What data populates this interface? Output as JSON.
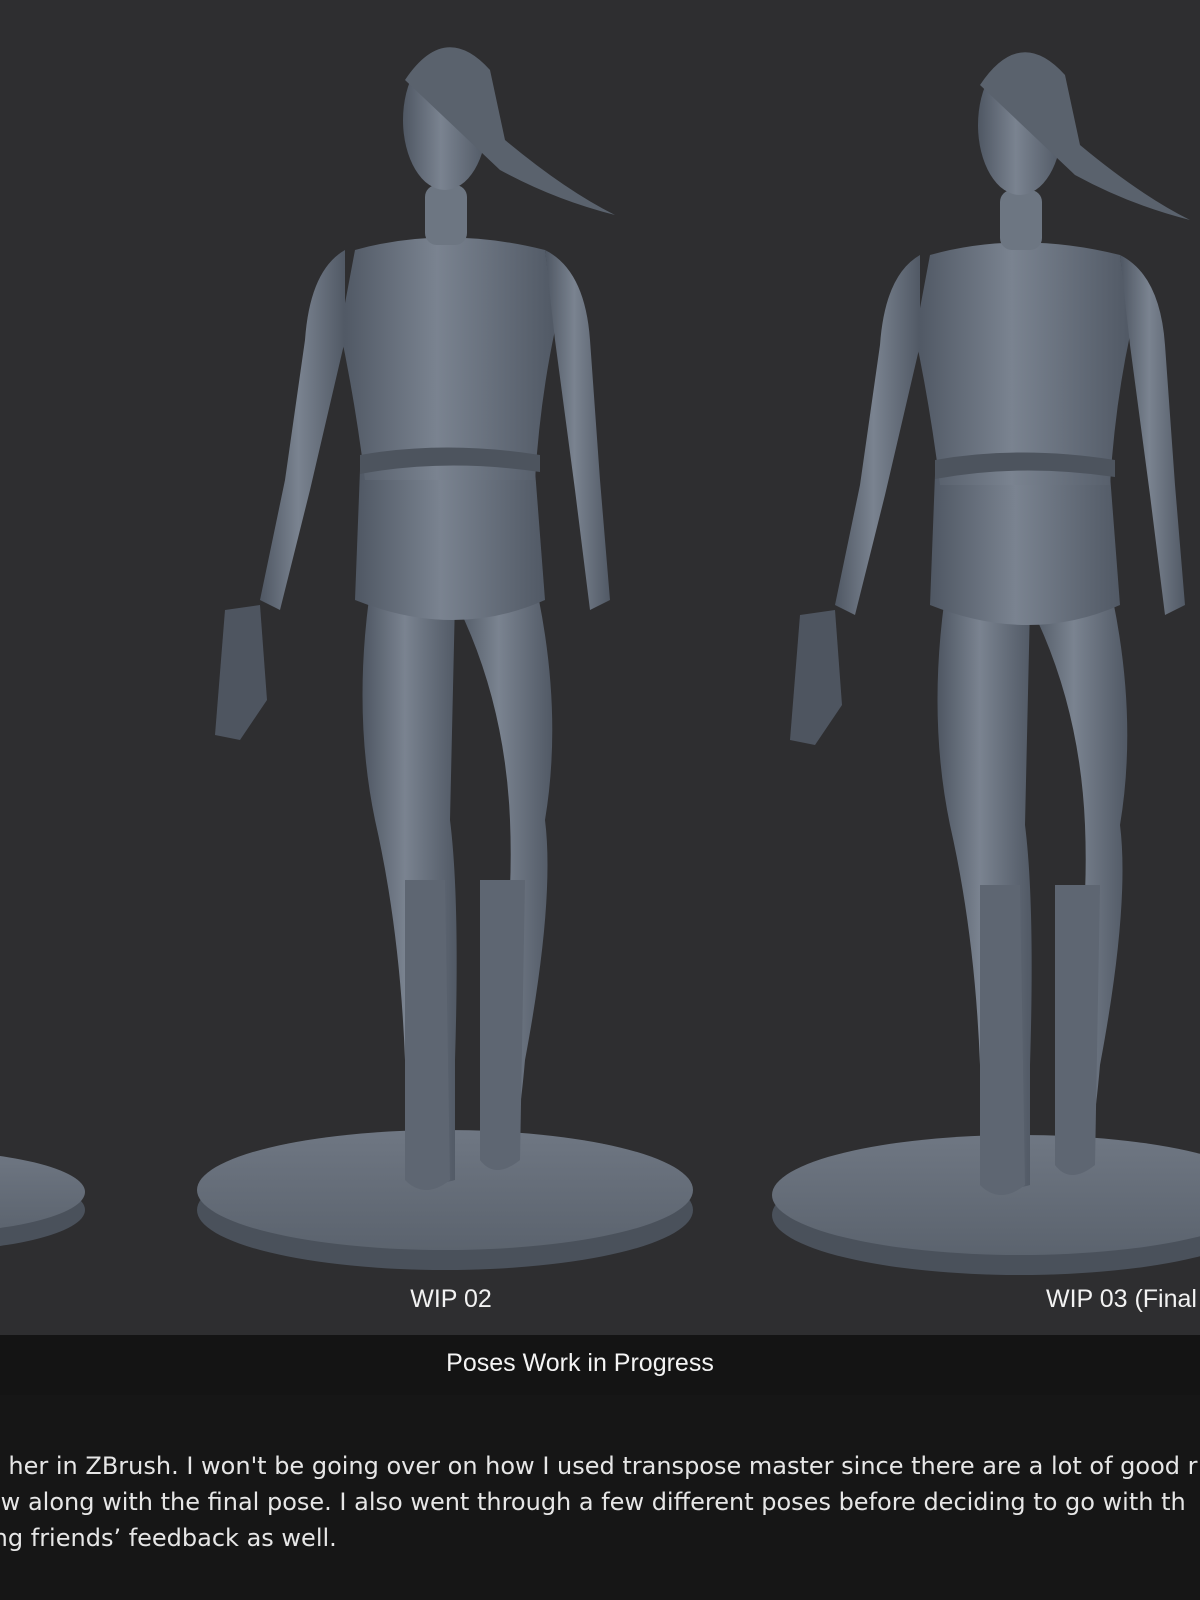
{
  "figures": {
    "labels": [
      "WIP 02",
      "WIP 03 (Final"
    ]
  },
  "caption": "Poses Work in Progress",
  "body_lines": [
    "e her in ZBrush. I won't be going over on how I used transpose master since there are a lot of good r",
    "ow along with the final pose. I also went through a few different poses before deciding to go with th",
    "ing friends’ feedback as well."
  ],
  "colors": {
    "render_background": "#2e2e30",
    "caption_background": "#141414",
    "sculpt_clay": "#6b7480"
  }
}
